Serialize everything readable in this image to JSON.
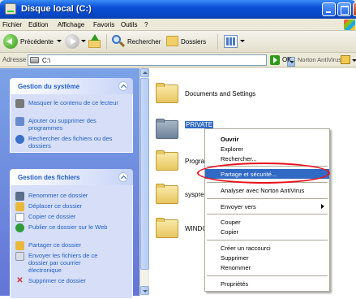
{
  "window": {
    "title": "Disque local (C:)"
  },
  "menubar": {
    "items": [
      "Fichier",
      "Edition",
      "Affichage",
      "Favoris",
      "Outils",
      "?"
    ]
  },
  "toolbar": {
    "back_label": "Précédente",
    "search_label": "Rechercher",
    "folders_label": "Dossiers"
  },
  "addressbar": {
    "label": "Adresse",
    "value": "C:\\",
    "go_label": "OK",
    "norton_label": "Norton AntiVirus"
  },
  "left_panel": {
    "system_tasks": {
      "title": "Gestion du système",
      "items": [
        {
          "label": "Masquer le contenu de ce lecteur",
          "icon": "hide-contents-icon",
          "color": "#7a7a7a"
        },
        {
          "label": "Ajouter ou supprimer des programmes",
          "icon": "add-remove-programs-icon",
          "color": "#6a8ad0"
        },
        {
          "label": "Rechercher des fichiers ou des dossiers",
          "icon": "search-icon",
          "color": "#3a70c8"
        }
      ]
    },
    "file_tasks": {
      "title": "Gestion des fichiers",
      "items": [
        {
          "label": "Renommer ce dossier",
          "icon": "rename-icon",
          "color": "#5b6e8c"
        },
        {
          "label": "Déplacer ce dossier",
          "icon": "move-icon",
          "color": "#e9b83a"
        },
        {
          "label": "Copier ce dossier",
          "icon": "copy-icon",
          "color": "#ffffff"
        },
        {
          "label": "Publier ce dossier sur le Web",
          "icon": "publish-web-icon",
          "color": "#2f9b3c"
        },
        {
          "label": "Partager ce dossier",
          "icon": "share-icon",
          "color": "#e9b83a"
        },
        {
          "label": "Envoyer les fichiers de ce dossier par courrier électronique",
          "icon": "email-icon",
          "color": "#d8dce6"
        },
        {
          "label": "Supprimer ce dossier",
          "icon": "delete-icon",
          "color": "#d22b2b"
        }
      ]
    }
  },
  "main": {
    "folders": [
      {
        "name": "Documents and Settings",
        "selected": false
      },
      {
        "name": "PRIVATE",
        "selected": true
      },
      {
        "name": "Program",
        "selected": false
      },
      {
        "name": "sysprep",
        "selected": false
      },
      {
        "name": "WINDO",
        "selected": false
      }
    ]
  },
  "context_menu": {
    "items": [
      {
        "label": "Ouvrir"
      },
      {
        "label": "Explorer"
      },
      {
        "label": "Rechercher..."
      },
      {
        "label": "Partage et sécurité..."
      },
      {
        "label": "Analyser avec Norton AntiVirus"
      },
      {
        "label": "Envoyer vers"
      },
      {
        "label": "Couper"
      },
      {
        "label": "Copier"
      },
      {
        "label": "Créer un raccourci"
      },
      {
        "label": "Supprimer"
      },
      {
        "label": "Renommer"
      },
      {
        "label": "Propriétés"
      }
    ],
    "highlight_color": "#316ac5",
    "annotation_color": "#e8121c"
  }
}
